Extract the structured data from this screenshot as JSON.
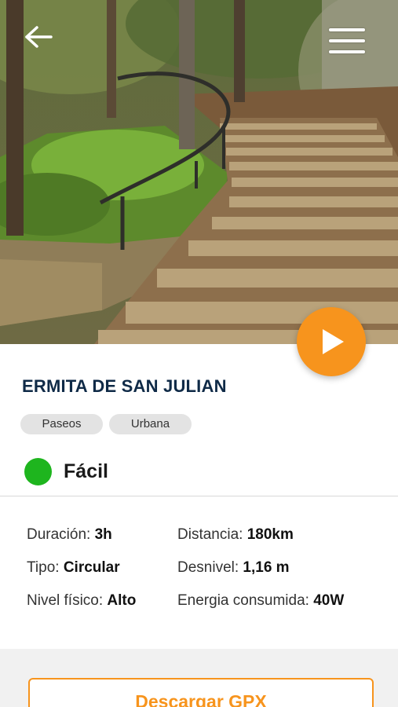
{
  "route": {
    "title": "ERMITA DE SAN JULIAN",
    "tags": [
      "Paseos",
      "Urbana"
    ],
    "difficulty": {
      "label": "Fácil",
      "color": "#1eb51e"
    }
  },
  "stats": {
    "duration": {
      "label": "Duración:",
      "value": "3h"
    },
    "distance": {
      "label": "Distancia:",
      "value": "180km"
    },
    "type": {
      "label": "Tipo:",
      "value": "Circular"
    },
    "elevation": {
      "label": "Desnivel:",
      "value": "1,16 m"
    },
    "fitness": {
      "label": "Nivel físico:",
      "value": "Alto"
    },
    "energy": {
      "label": "Energia consumida:",
      "value": "40W"
    }
  },
  "actions": {
    "download_gpx": "Descargar GPX"
  },
  "icons": {
    "back": "arrow-left-icon",
    "menu": "hamburger-menu-icon",
    "play": "play-icon"
  },
  "colors": {
    "accent": "#f7941d",
    "title": "#0f2a47",
    "easy": "#1eb51e"
  }
}
